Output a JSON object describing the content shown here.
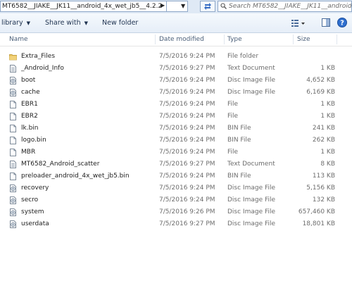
{
  "address": {
    "path": "MT6582__JIAKE__JK11__android_4x_wet_jb5__4.2.2",
    "search_placeholder": "Search MT6582__JIAKE__JK11__android..."
  },
  "toolbar": {
    "library": "library",
    "share_with": "Share with",
    "new_folder": "New folder"
  },
  "columns": {
    "name": "Name",
    "date": "Date modified",
    "type": "Type",
    "size": "Size"
  },
  "files": [
    {
      "name": "Extra_Files",
      "date": "7/5/2016 9:24 PM",
      "type": "File folder",
      "size": "",
      "icon": "folder-icon"
    },
    {
      "name": "_Android_Info",
      "date": "7/5/2016 9:27 PM",
      "type": "Text Document",
      "size": "1 KB",
      "icon": "text-file-icon"
    },
    {
      "name": "boot",
      "date": "7/5/2016 9:24 PM",
      "type": "Disc Image File",
      "size": "4,652 KB",
      "icon": "disc-image-icon"
    },
    {
      "name": "cache",
      "date": "7/5/2016 9:24 PM",
      "type": "Disc Image File",
      "size": "6,169 KB",
      "icon": "disc-image-icon"
    },
    {
      "name": "EBR1",
      "date": "7/5/2016 9:24 PM",
      "type": "File",
      "size": "1 KB",
      "icon": "file-icon"
    },
    {
      "name": "EBR2",
      "date": "7/5/2016 9:24 PM",
      "type": "File",
      "size": "1 KB",
      "icon": "file-icon"
    },
    {
      "name": "lk.bin",
      "date": "7/5/2016 9:24 PM",
      "type": "BIN File",
      "size": "241 KB",
      "icon": "file-icon"
    },
    {
      "name": "logo.bin",
      "date": "7/5/2016 9:24 PM",
      "type": "BIN File",
      "size": "262 KB",
      "icon": "file-icon"
    },
    {
      "name": "MBR",
      "date": "7/5/2016 9:24 PM",
      "type": "File",
      "size": "1 KB",
      "icon": "file-icon"
    },
    {
      "name": "MT6582_Android_scatter",
      "date": "7/5/2016 9:27 PM",
      "type": "Text Document",
      "size": "8 KB",
      "icon": "text-file-icon"
    },
    {
      "name": "preloader_android_4x_wet_jb5.bin",
      "date": "7/5/2016 9:24 PM",
      "type": "BIN File",
      "size": "113 KB",
      "icon": "file-icon"
    },
    {
      "name": "recovery",
      "date": "7/5/2016 9:24 PM",
      "type": "Disc Image File",
      "size": "5,156 KB",
      "icon": "disc-image-icon"
    },
    {
      "name": "secro",
      "date": "7/5/2016 9:24 PM",
      "type": "Disc Image File",
      "size": "132 KB",
      "icon": "disc-image-icon"
    },
    {
      "name": "system",
      "date": "7/5/2016 9:26 PM",
      "type": "Disc Image File",
      "size": "657,460 KB",
      "icon": "disc-image-icon"
    },
    {
      "name": "userdata",
      "date": "7/5/2016 9:27 PM",
      "type": "Disc Image File",
      "size": "18,801 KB",
      "icon": "disc-image-icon"
    }
  ]
}
